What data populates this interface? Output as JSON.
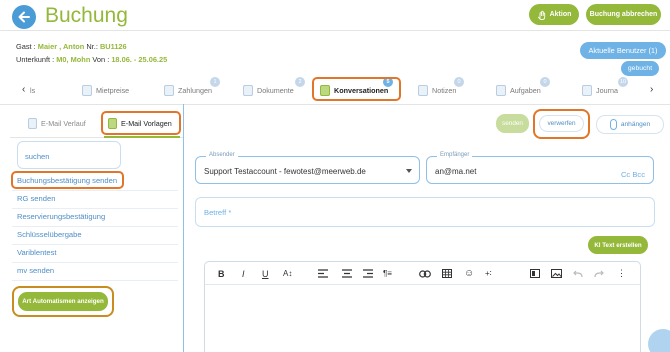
{
  "header": {
    "title": "Buchung",
    "aktion_label": "Aktion",
    "abbrechen_label": "Buchung abbrechen"
  },
  "info": {
    "gast_label": "Gast : ",
    "gast_name": "Maier , Anton",
    "nr_label": " Nr.: ",
    "nr_value": "BU1126",
    "unterkunft_label": "Unterkunft : ",
    "unterkunft_value": "M0, Mohn",
    "von_label": " Von : ",
    "von_value": "18.06. - 25.06.25"
  },
  "user": {
    "current_users": "Aktuelle Benutzer (1)",
    "status": "gebucht"
  },
  "tabs": [
    {
      "label": "ls",
      "badge": ""
    },
    {
      "label": "Mietpreise",
      "badge": ""
    },
    {
      "label": "Zahlungen",
      "badge": "1"
    },
    {
      "label": "Dokumente",
      "badge": "2"
    },
    {
      "label": "Konversationen",
      "badge": "5"
    },
    {
      "label": "Notizen",
      "badge": "0"
    },
    {
      "label": "Aufgaben",
      "badge": "0"
    },
    {
      "label": "Journa",
      "badge": "10"
    }
  ],
  "subtabs": {
    "verlauf": "E-Mail Verlauf",
    "vorlagen": "E-Mail Vorlagen"
  },
  "search": {
    "placeholder": "suchen"
  },
  "templates": [
    "Buchungsbestätigung senden",
    "RG senden",
    "Reservierungsbestätigung",
    "Schlüsselübergabe",
    "Variblentest",
    "mv senden"
  ],
  "automation_label": "Art Automatismen anzeigen",
  "compose": {
    "send_label": "senden",
    "discard_label": "verwerfen",
    "attach_label": "anhängen",
    "sender_label": "Absender",
    "sender_value": "Support Testaccount - fewotest@meerweb.de",
    "recipient_label": "Empfänger",
    "recipient_value": "an@ma.net",
    "cc_bcc": "Cc Bcc",
    "subject_placeholder": "Betreff *",
    "ai_label": "KI Text erstellen"
  },
  "toolbar": {
    "bold": "B",
    "italic": "I",
    "underline": "U",
    "font_size": "A↕",
    "paragraph": "¶≡",
    "emoji": "☺",
    "insert": "+∶",
    "more": "⋮"
  },
  "colors": {
    "accent_green": "#94b83a",
    "accent_blue": "#4a9bd6",
    "highlight_orange": "#e0762a"
  }
}
